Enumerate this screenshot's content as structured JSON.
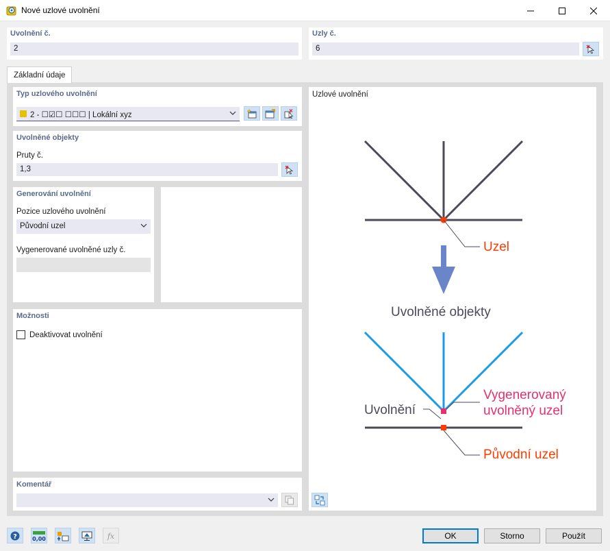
{
  "window": {
    "title": "Nové uzlové uvolnění"
  },
  "release_no": {
    "label": "Uvolnění č.",
    "value": "2"
  },
  "nodes_no": {
    "label": "Uzly č.",
    "value": "6"
  },
  "tabs": [
    {
      "label": "Základní údaje"
    }
  ],
  "release_type": {
    "title": "Typ uzlového uvolnění",
    "color": "#e8c000",
    "value": "2 - ☐☑☐ ☐☐☐ | Lokální xyz"
  },
  "released_objects": {
    "title": "Uvolněné objekty",
    "members_label": "Pruty č.",
    "members_value": "1,3"
  },
  "generation": {
    "title": "Generování uvolnění",
    "position_label": "Pozice uzlového uvolnění",
    "position_value": "Původní uzel",
    "generated_label": "Vygenerované uvolněné uzly č.",
    "generated_value": ""
  },
  "options": {
    "title": "Možnosti",
    "deactivate_label": "Deaktivovat uvolnění",
    "deactivate_checked": false
  },
  "comment": {
    "title": "Komentář",
    "value": ""
  },
  "diagram": {
    "title": "Uzlové uvolnění",
    "node_label": "Uzel",
    "released_objects_label": "Uvolněné objekty",
    "release_label": "Uvolnění",
    "generated_node_label_1": "Vygenerovaný",
    "generated_node_label_2": "uvolněný uzel",
    "original_node_label": "Původní uzel",
    "colors": {
      "member_gray": "#4a4a5a",
      "member_blue": "#1c9be6",
      "node_orange": "#ff3c00",
      "generated_pink": "#e6306e",
      "arrow_blue": "#6b86c8"
    }
  },
  "buttons": {
    "ok": "OK",
    "cancel": "Storno",
    "apply": "Použít"
  }
}
